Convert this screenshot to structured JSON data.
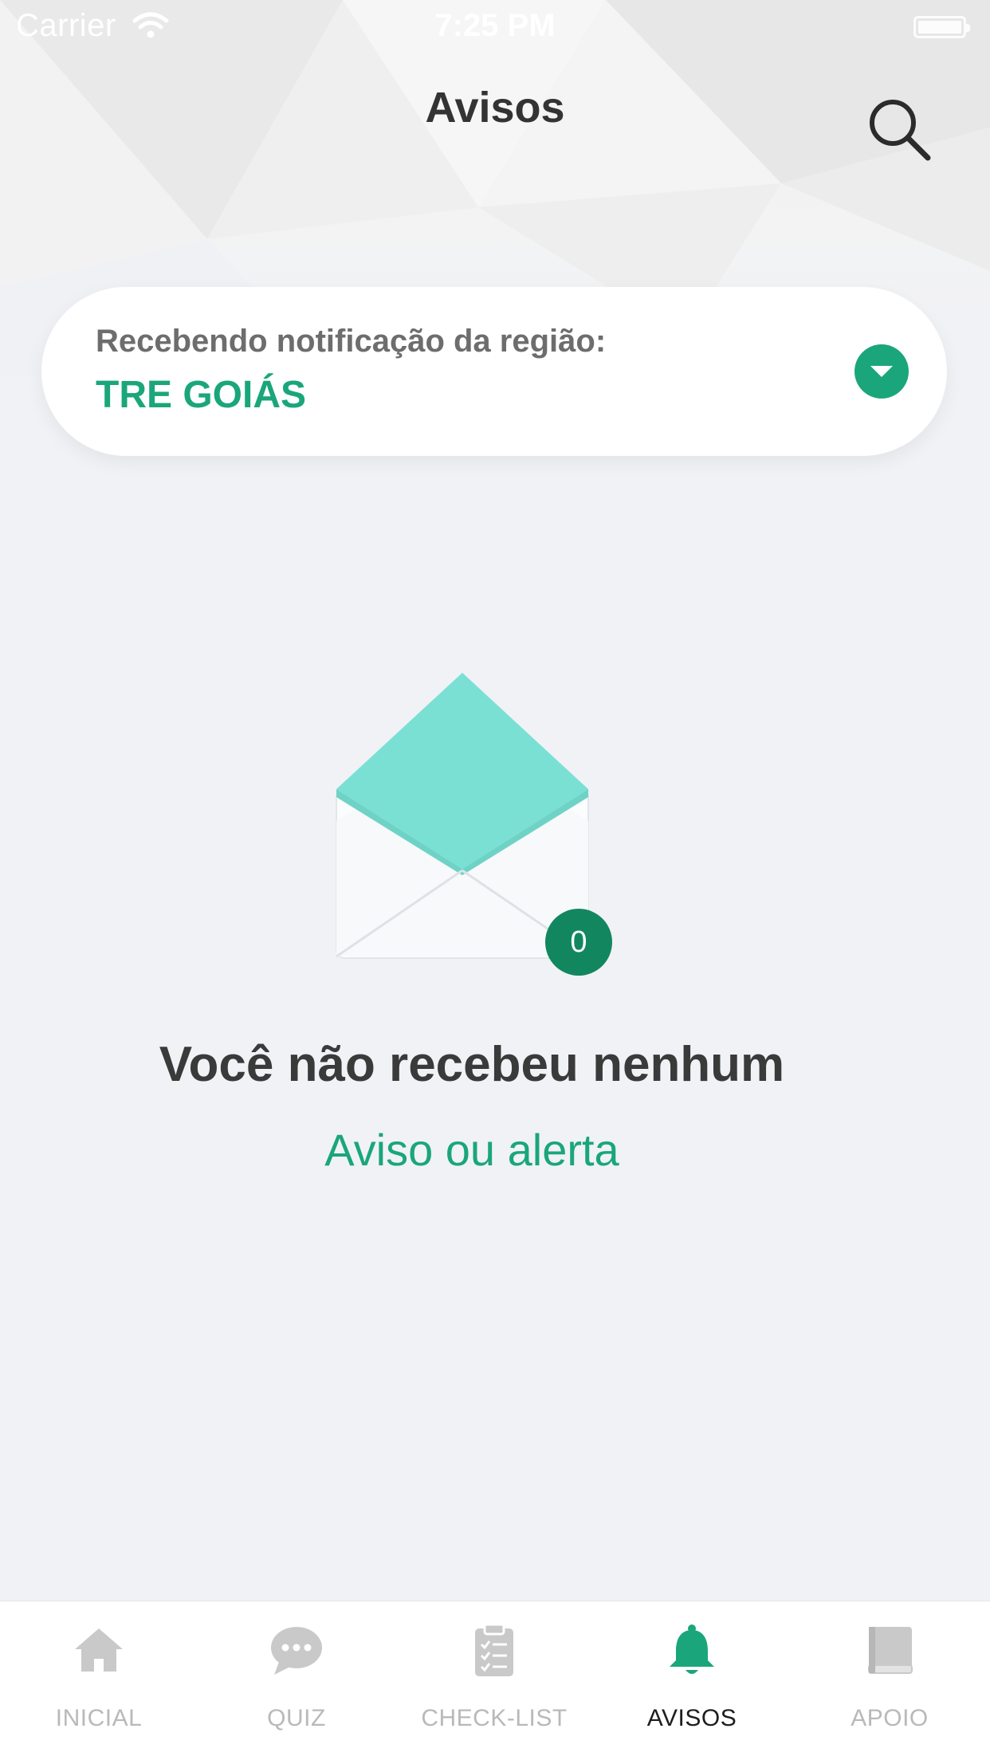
{
  "status_bar": {
    "carrier": "Carrier",
    "time": "7:25 PM"
  },
  "header": {
    "title": "Avisos",
    "search_icon": "search-icon"
  },
  "region": {
    "label": "Recebendo notificação da região:",
    "value": "TRE GOIÁS",
    "dropdown_icon": "chevron-down-icon"
  },
  "empty_state": {
    "icon": "open-envelope-icon",
    "count": "0",
    "title": "Você não recebeu nenhum",
    "subtitle": "Aviso ou alerta"
  },
  "tab_bar": {
    "active": "AVISOS",
    "items": [
      {
        "label": "INICIAL",
        "icon": "home-icon"
      },
      {
        "label": "QUIZ",
        "icon": "chat-bubble-icon"
      },
      {
        "label": "CHECK-LIST",
        "icon": "clipboard-checklist-icon"
      },
      {
        "label": "AVISOS",
        "icon": "bell-icon"
      },
      {
        "label": "APOIO",
        "icon": "book-icon"
      }
    ]
  },
  "colors": {
    "accent": "#1aa67a",
    "badge": "#12875f",
    "envelope_flap": "#7ae0d4",
    "background": "#f0f2f6",
    "inactive_tab": "#b9b9b9"
  }
}
